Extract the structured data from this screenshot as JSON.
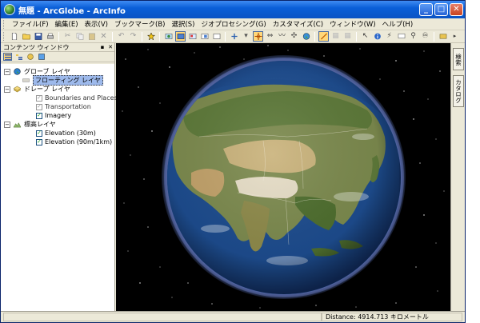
{
  "window": {
    "title": "無題 - ArcGlobe - ArcInfo",
    "minimize_glyph": "_",
    "maximize_glyph": "□",
    "close_glyph": "✕"
  },
  "menu": {
    "items": [
      {
        "label": "ファイル(F)"
      },
      {
        "label": "編集(E)"
      },
      {
        "label": "表示(V)"
      },
      {
        "label": "ブックマーク(B)"
      },
      {
        "label": "選択(S)"
      },
      {
        "label": "ジオプロセシング(G)"
      },
      {
        "label": "カスタマイズ(C)"
      },
      {
        "label": "ウィンドウ(W)"
      },
      {
        "label": "ヘルプ(H)"
      }
    ]
  },
  "toolbar": {
    "icons": [
      "new-document-icon",
      "open-folder-icon",
      "save-icon",
      "print-icon",
      "cut-icon",
      "copy-icon",
      "paste-icon",
      "delete-icon",
      "undo-icon",
      "redo-icon",
      "add-data-icon",
      "full-extent-icon",
      "view-icon",
      "layer-view-icon",
      "map-view-icon",
      "frame-icon",
      "navigate-icon",
      "fly-icon",
      "target-icon",
      "zoom-icon",
      "globe-icon",
      "pan-icon",
      "extent-icon",
      "identify-icon",
      "find-icon",
      "measure-icon",
      "hyperlink-icon",
      "search-icon",
      "options-icon"
    ]
  },
  "toc": {
    "title": "コンテンツ ウィンドウ",
    "pin_glyph": "▪",
    "close_glyph": "✕",
    "tools": [
      "list-by-drawing-order-icon",
      "list-by-source-icon",
      "list-by-visibility-icon",
      "list-by-selection-icon"
    ],
    "groups": [
      {
        "label": "グローブ レイヤ",
        "expander": "−",
        "layers": [
          {
            "label": "フローティング レイヤ",
            "selected": true
          }
        ]
      },
      {
        "label": "ドレープ レイヤ",
        "expander": "−",
        "layers": [
          {
            "label": "Boundaries and Places",
            "checked": false
          },
          {
            "label": "Transportation",
            "checked": false
          },
          {
            "label": "Imagery",
            "checked": true
          }
        ]
      },
      {
        "label": "標高レイヤ",
        "expander": "−",
        "layers": [
          {
            "label": "Elevation (30m)",
            "checked": true
          },
          {
            "label": "Elevation (90m/1km)",
            "checked": true
          }
        ]
      }
    ]
  },
  "side_tabs": [
    {
      "label": "検索"
    },
    {
      "label": "カタログ"
    }
  ],
  "status": {
    "distance": "Distance:  4914.713 キロメートル"
  },
  "colors": {
    "title_bar": "#0a5fd8",
    "chrome": "#ece9d8",
    "selection": "#9db9eb",
    "space": "#000000"
  }
}
